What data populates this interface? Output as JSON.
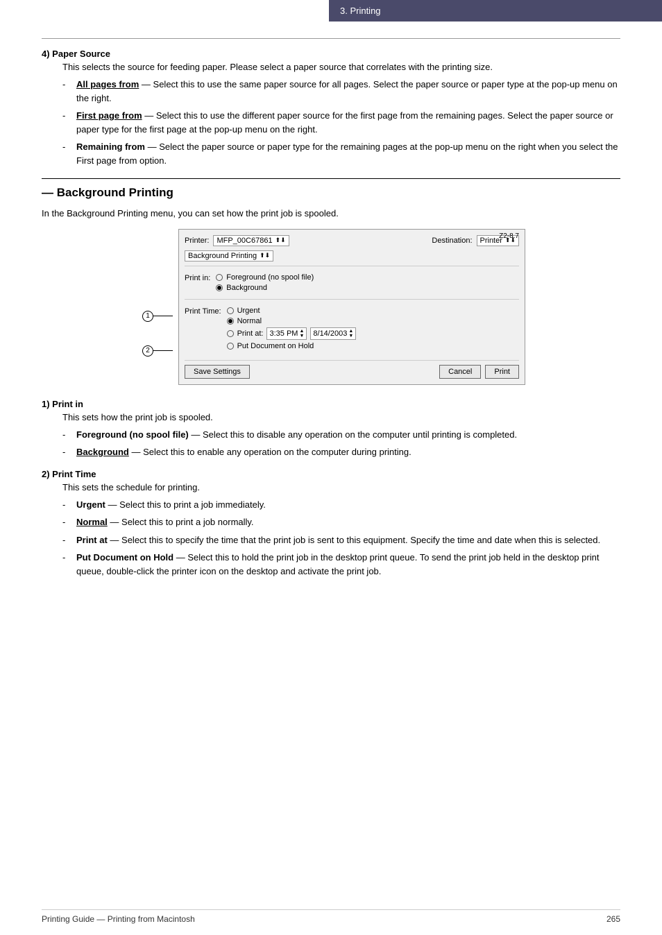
{
  "header": {
    "title": "3.  Printing"
  },
  "footer": {
    "left": "Printing Guide — Printing from Macintosh",
    "right": "265"
  },
  "paper_source": {
    "heading": "4)  Paper Source",
    "intro": "This selects the source for feeding paper. Please select a paper source that correlates with the printing size.",
    "items": [
      {
        "term": "All pages from",
        "text": "— Select this to use the same paper source for all pages. Select the paper source or paper type at the pop-up menu on the right."
      },
      {
        "term": "First page from",
        "text": "— Select this to use the different paper source for the first page from the remaining pages.  Select the paper source or paper type for the first page at the pop-up menu on the right."
      },
      {
        "term": "Remaining from",
        "text": "— Select the paper source or paper type for the remaining pages at the pop-up menu on the right when you select the First page from option."
      }
    ]
  },
  "bg_printing": {
    "title": "— Background Printing",
    "intro": "In the Background Printing menu, you can set how the print job is spooled.",
    "dialog": {
      "version": "Z2-8.7",
      "printer_label": "Printer:",
      "printer_value": "MFP_00C67861",
      "destination_label": "Destination:",
      "destination_value": "Printer",
      "menu_label": "Background Printing",
      "print_in_label": "Print in:",
      "options": {
        "foreground_label": "Foreground (no spool file)",
        "background_label": "Background"
      },
      "print_time_label": "Print Time:",
      "time_options": {
        "urgent_label": "Urgent",
        "normal_label": "Normal",
        "print_at_label": "Print at:",
        "time_value": "3:35 PM",
        "date_value": "8/14/2003",
        "hold_label": "Put Document on Hold"
      },
      "save_btn": "Save Settings",
      "cancel_btn": "Cancel",
      "print_btn": "Print"
    },
    "annotation1": "①",
    "annotation2": "②"
  },
  "print_in_section": {
    "heading": "1)  Print in",
    "intro": "This sets how the print job is spooled.",
    "items": [
      {
        "term": "Foreground (no spool file)",
        "text": "— Select this to disable any operation on the computer until printing is completed."
      },
      {
        "term": "Background",
        "text": "— Select this to enable any operation on the computer during printing."
      }
    ]
  },
  "print_time_section": {
    "heading": "2)  Print Time",
    "intro": "This sets the schedule for printing.",
    "items": [
      {
        "term": "Urgent",
        "text": "— Select this to print a job immediately."
      },
      {
        "term": "Normal",
        "text": "— Select this to print a job normally."
      },
      {
        "term": "Print at",
        "text": "— Select this to specify the time that the print job is sent to this equipment. Specify the time and date when this is selected."
      },
      {
        "term": "Put Document on Hold",
        "text": "— Select this to hold the print job in the desktop print queue. To send the print job held in the desktop print queue, double-click the printer icon on the desktop and activate the print job."
      }
    ]
  }
}
